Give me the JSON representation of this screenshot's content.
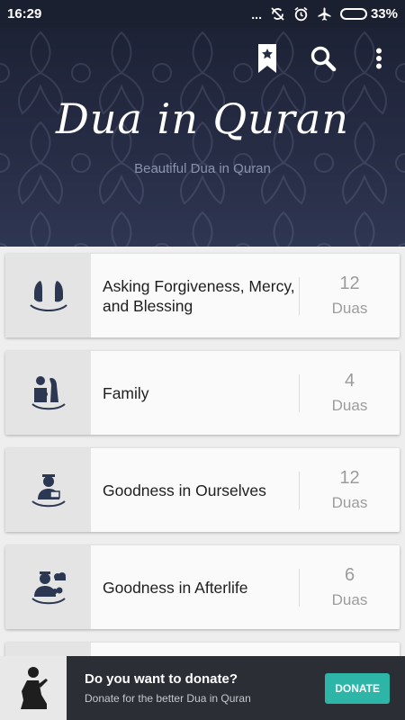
{
  "status_bar": {
    "time": "16:29",
    "dots": "...",
    "battery_level": "33%",
    "battery_fraction": 0.33,
    "icons": [
      "more-dots-icon",
      "no-sync-icon",
      "alarm-icon",
      "airplane-mode-icon",
      "battery-icon"
    ]
  },
  "header": {
    "title": "Dua in Quran",
    "subtitle": "Beautiful Dua in Quran",
    "actions": [
      "bookmark-icon",
      "search-icon",
      "more-vert-icon"
    ]
  },
  "categories": [
    {
      "label": "Asking Forgiveness, Mercy, and Blessing",
      "count": "12",
      "unit": "Duas",
      "icon": "praying-hands-icon"
    },
    {
      "label": "Family",
      "count": "4",
      "unit": "Duas",
      "icon": "family-icon"
    },
    {
      "label": "Goodness in Ourselves",
      "count": "12",
      "unit": "Duas",
      "icon": "man-reading-icon"
    },
    {
      "label": "Goodness in Afterlife",
      "count": "6",
      "unit": "Duas",
      "icon": "man-in-heaven-icon"
    }
  ],
  "banner": {
    "title": "Do you want to donate?",
    "text": "Donate for the better Dua in Quran",
    "button": "DONATE",
    "icon": "praying-person-icon"
  },
  "colors": {
    "header_bg": "#262c44",
    "accent": "#2db5a8",
    "icon_color": "#2c3852"
  }
}
